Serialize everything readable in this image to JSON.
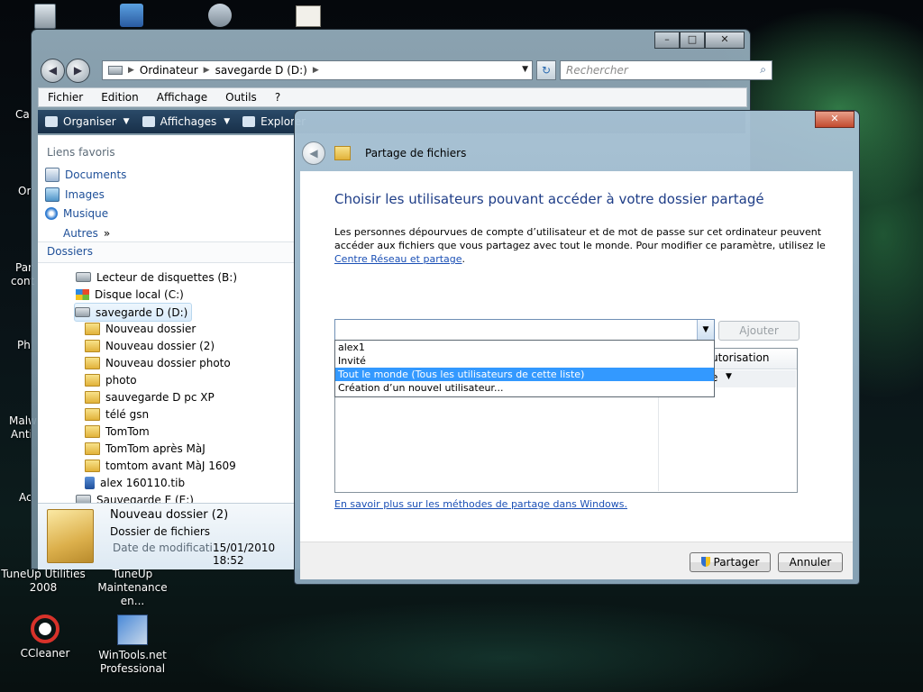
{
  "desktop": {
    "icons": [
      {
        "label": "CCleaner"
      },
      {
        "label": "WinTools.net Professional"
      },
      {
        "label": "TuneUp Utilities 2008"
      },
      {
        "label": "TuneUp Maintenance en..."
      }
    ],
    "partial_labels": [
      "Ca",
      "Or",
      "Par",
      "cont",
      "Ph",
      "Malw",
      "Anti",
      "Ac"
    ]
  },
  "explorer": {
    "breadcrumb": [
      "Ordinateur",
      "savegarde D (D:)"
    ],
    "search_placeholder": "Rechercher",
    "menu": [
      "Fichier",
      "Edition",
      "Affichage",
      "Outils",
      "?"
    ],
    "commands": [
      "Organiser",
      "Affichages",
      "Explorer"
    ],
    "favorites_heading": "Liens favoris",
    "favorites": [
      "Documents",
      "Images",
      "Musique",
      "Autres"
    ],
    "favorites_more": "»",
    "folders_heading": "Dossiers",
    "tree": [
      {
        "label": "Lecteur de disquettes (B:)",
        "type": "drive"
      },
      {
        "label": "Disque local (C:)",
        "type": "drive"
      },
      {
        "label": "savegarde D (D:)",
        "type": "drive"
      },
      {
        "label": "Nouveau dossier",
        "type": "folder"
      },
      {
        "label": "Nouveau dossier (2)",
        "type": "folder"
      },
      {
        "label": "Nouveau dossier photo",
        "type": "folder"
      },
      {
        "label": "photo",
        "type": "folder"
      },
      {
        "label": "sauvegarde  D pc XP",
        "type": "folder"
      },
      {
        "label": "télé gsn",
        "type": "folder"
      },
      {
        "label": "TomTom",
        "type": "folder"
      },
      {
        "label": "TomTom après MàJ",
        "type": "folder"
      },
      {
        "label": "tomtom avant MàJ 1609",
        "type": "folder"
      },
      {
        "label": "alex 160110.tib",
        "type": "file"
      },
      {
        "label": "Sauvegarde  E (E:)",
        "type": "drive"
      }
    ],
    "details": {
      "name": "Nouveau dossier (2)",
      "type": "Dossier de fichiers",
      "date_label": "Date de modificati...",
      "date_value": "15/01/2010 18:52"
    }
  },
  "dialog": {
    "title": "Partage de fichiers",
    "heading": "Choisir les utilisateurs pouvant accéder à votre dossier partagé",
    "paragraph": "Les personnes dépourvues de compte d’utilisateur et de mot de passe sur cet ordinateur peuvent accéder aux fichiers que vous partagez avec tout le monde. Pour modifier ce paramètre, utilisez le ",
    "paragraph_link": "Centre Réseau et partage",
    "paragraph_end": ".",
    "combo_value": "",
    "add_button": "Ajouter",
    "dropdown_options": [
      "alex1",
      "Invité",
      "Tout le monde (Tous les utilisateurs de cette liste)",
      "Création d’un nouvel utilisateur..."
    ],
    "selected_option_index": 2,
    "list_col2_header": "utorisation",
    "list_row1_col2": "e",
    "learn_more_link": "En savoir plus sur les méthodes de partage dans Windows.",
    "share_button": "Partager",
    "cancel_button": "Annuler"
  },
  "colors": {
    "heading": "#1e3d87",
    "link": "#1a4fb5",
    "selection": "#3399ff"
  }
}
